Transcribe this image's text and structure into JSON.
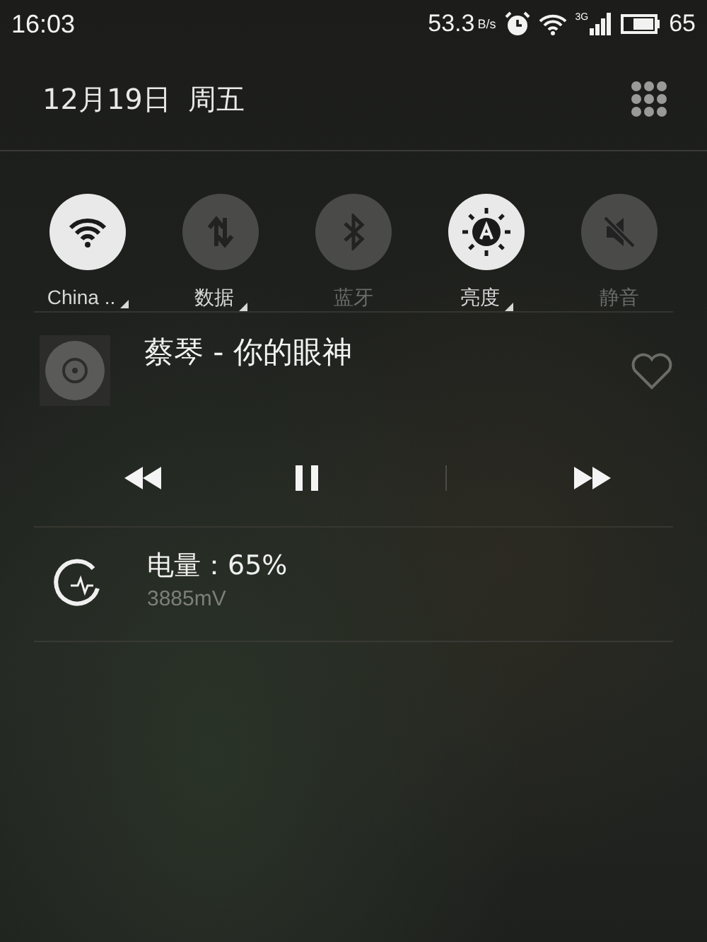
{
  "status_bar": {
    "time": "16:03",
    "speed": "53.3",
    "speed_unit": "B/s",
    "network": "3G",
    "battery": "65"
  },
  "header": {
    "date": "12月19日",
    "weekday": "周五"
  },
  "toggles": [
    {
      "kind": "wifi",
      "label": "China ..",
      "on": true,
      "has_menu": true
    },
    {
      "kind": "data",
      "label": "数据",
      "on": false,
      "has_menu": true
    },
    {
      "kind": "bluetooth",
      "label": "蓝牙",
      "on": false,
      "has_menu": false
    },
    {
      "kind": "brightness",
      "label": "亮度",
      "on": true,
      "has_menu": true
    },
    {
      "kind": "mute",
      "label": "静音",
      "on": false,
      "has_menu": false
    }
  ],
  "music": {
    "title": "蔡琴 - 你的眼神",
    "liked": false,
    "playing": true
  },
  "battery_card": {
    "charge": "电量：65%",
    "voltage": "3885mV"
  }
}
